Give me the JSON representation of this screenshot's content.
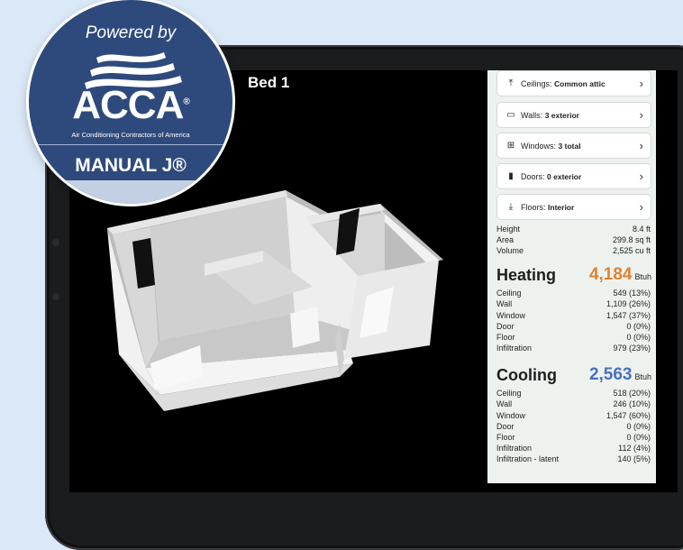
{
  "room_title": "Bed 1",
  "rows": [
    {
      "icon": "ceiling-icon",
      "glyph": "⤒",
      "label": "Ceilings:",
      "value": "Common attic"
    },
    {
      "icon": "wall-icon",
      "glyph": "▭",
      "label": "Walls:",
      "value": "3 exterior"
    },
    {
      "icon": "window-icon",
      "glyph": "⊞",
      "label": "Windows:",
      "value": "3 total"
    },
    {
      "icon": "door-icon",
      "glyph": "▮",
      "label": "Doors:",
      "value": "0 exterior"
    },
    {
      "icon": "floor-icon",
      "glyph": "⤓",
      "label": "Floors:",
      "value": "Interior"
    }
  ],
  "dimensions": [
    {
      "label": "Height",
      "value": "8.4 ft"
    },
    {
      "label": "Area",
      "value": "299.8 sq ft"
    },
    {
      "label": "Volume",
      "value": "2,525 cu ft"
    }
  ],
  "heating": {
    "title": "Heating",
    "total": "4,184",
    "unit": "Btuh",
    "color": "#e0822f",
    "items": [
      {
        "label": "Ceiling",
        "value": "549 (13%)"
      },
      {
        "label": "Wall",
        "value": "1,109 (26%)"
      },
      {
        "label": "Window",
        "value": "1,547 (37%)"
      },
      {
        "label": "Door",
        "value": "0 (0%)"
      },
      {
        "label": "Floor",
        "value": "0 (0%)"
      },
      {
        "label": "Infiltration",
        "value": "979 (23%)"
      }
    ]
  },
  "cooling": {
    "title": "Cooling",
    "total": "2,563",
    "unit": "Btuh",
    "color": "#4a6fbf",
    "items": [
      {
        "label": "Ceiling",
        "value": "518 (20%)"
      },
      {
        "label": "Wall",
        "value": "246 (10%)"
      },
      {
        "label": "Window",
        "value": "1,547 (60%)"
      },
      {
        "label": "Door",
        "value": "0 (0%)"
      },
      {
        "label": "Floor",
        "value": "0 (0%)"
      },
      {
        "label": "Infiltration",
        "value": "112 (4%)"
      },
      {
        "label": "Infiltration - latent",
        "value": "140 (5%)"
      }
    ]
  },
  "badge": {
    "powered_by": "Powered by",
    "acca": "ACCA",
    "reg": "®",
    "subtitle": "Air Conditioning Contractors of America",
    "manual": "MANUAL J®"
  }
}
